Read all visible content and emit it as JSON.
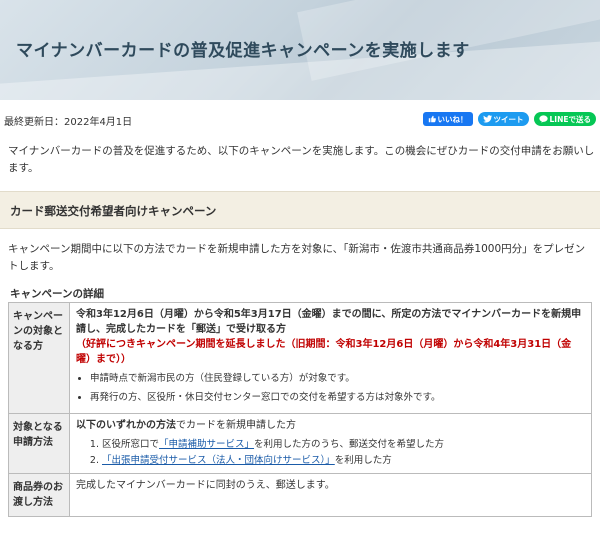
{
  "header": {
    "title": "マイナンバーカードの普及促進キャンペーンを実施します"
  },
  "meta": {
    "updated_label": "最終更新日：2022年4月1日",
    "share": {
      "facebook_label": "いいね！",
      "twitter_label": "ツイート",
      "line_label": "LINEで送る"
    }
  },
  "intro": "マイナンバーカードの普及を促進するため、以下のキャンペーンを実施します。この機会にぜひカードの交付申請をお願いします。",
  "section": {
    "heading": "カード郵送交付希望者向けキャンペーン",
    "description": "キャンペーン期間中に以下の方法でカードを新規申請した方を対象に、「新潟市・佐渡市共通商品券1000円分」をプレゼントします。",
    "detail_title": "キャンペーンの詳細",
    "rows": [
      {
        "header": "キャンペーンの対象となる方",
        "main_text": "令和3年12月6日（月曜）から令和5年3月17日（金曜）までの間に、所定の方法でマイナンバーカードを新規申請し、完成したカードを「郵送」で受け取る方",
        "notice": "（好評につきキャンペーン期間を延長しました（旧期間：令和3年12月6日（月曜）から令和4年3月31日（金曜）まで））",
        "bullets": [
          "申請時点で新潟市民の方（住民登録している方）が対象です。",
          "再発行の方、区役所・休日交付センター窓口での交付を希望する方は対象外です。"
        ]
      },
      {
        "header": "対象となる申請方法",
        "lead_strong": "以下のいずれかの方法",
        "lead_rest": "でカードを新規申請した方",
        "methods": [
          {
            "prefix": "区役所窓口で",
            "link": "「申請補助サービス」",
            "suffix": "を利用した方のうち、郵送交付を希望した方"
          },
          {
            "prefix": "",
            "link": "「出張申請受付サービス（法人・団体向けサービス）」",
            "suffix": "を利用した方"
          }
        ]
      },
      {
        "header": "商品券のお渡し方法",
        "text": "完成したマイナンバーカードに同封のうえ、郵送します。"
      }
    ]
  }
}
